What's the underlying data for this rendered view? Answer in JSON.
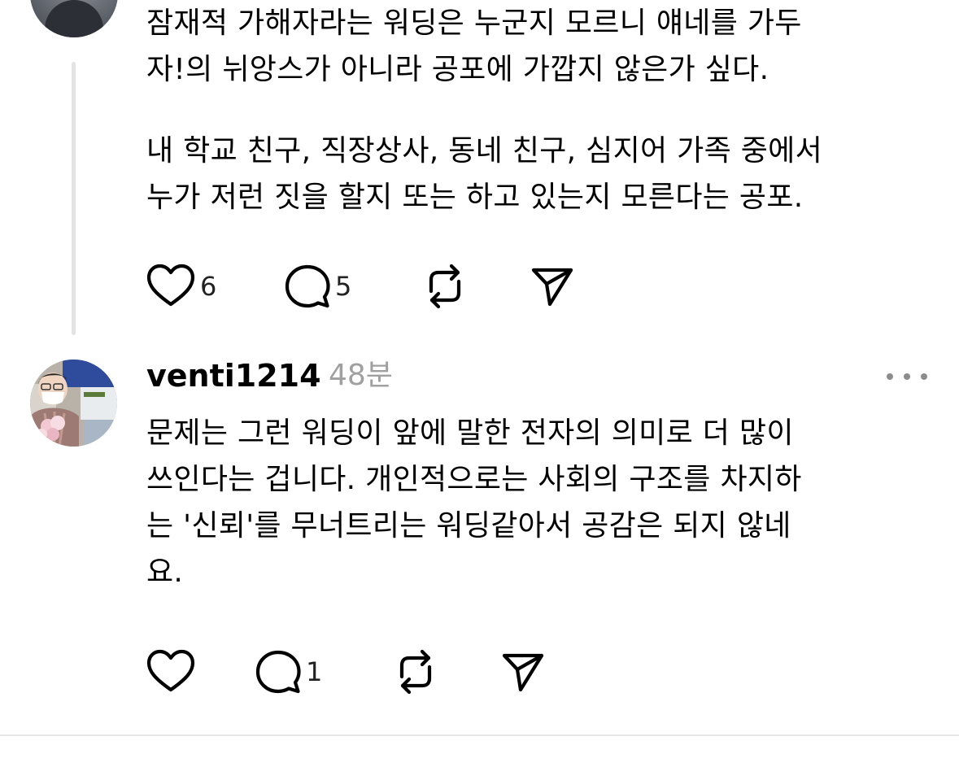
{
  "thread_reply": {
    "paragraphs": [
      [
        "잠재적 가해자라는 워딩은 누군지 모르니 얘네를 가두",
        "자!의 뉘앙스가 아니라 공포에 가깝지 않은가 싶다."
      ],
      [
        "내 학교 친구, 직장상사, 동네 친구, 심지어 가족 중에서",
        "누가 저런 짓을 할지 또는 하고 있는지 모른다는 공포."
      ]
    ],
    "actions": {
      "like_count": "6",
      "reply_count": "5"
    }
  },
  "comment": {
    "username": "venti1214",
    "timestamp": "48분",
    "lines": [
      "문제는 그런 워딩이 앞에 말한 전자의 의미로 더 많이",
      "쓰인다는 겁니다. 개인적으로는 사회의 구조를 차지하",
      "는 '신뢰'를 무너트리는 워딩같아서 공감은 되지 않네",
      "요."
    ],
    "actions": {
      "like_count": "",
      "reply_count": "1"
    }
  },
  "icons": {
    "like": "heart-icon",
    "reply": "comment-bubble-icon",
    "repost": "repost-icon",
    "share": "send-icon",
    "more": "more-dots-icon"
  },
  "colors": {
    "text": "#000000",
    "muted": "#a0a0a0",
    "thread_line": "#e3e3e3",
    "divider": "#e6e6e6"
  }
}
